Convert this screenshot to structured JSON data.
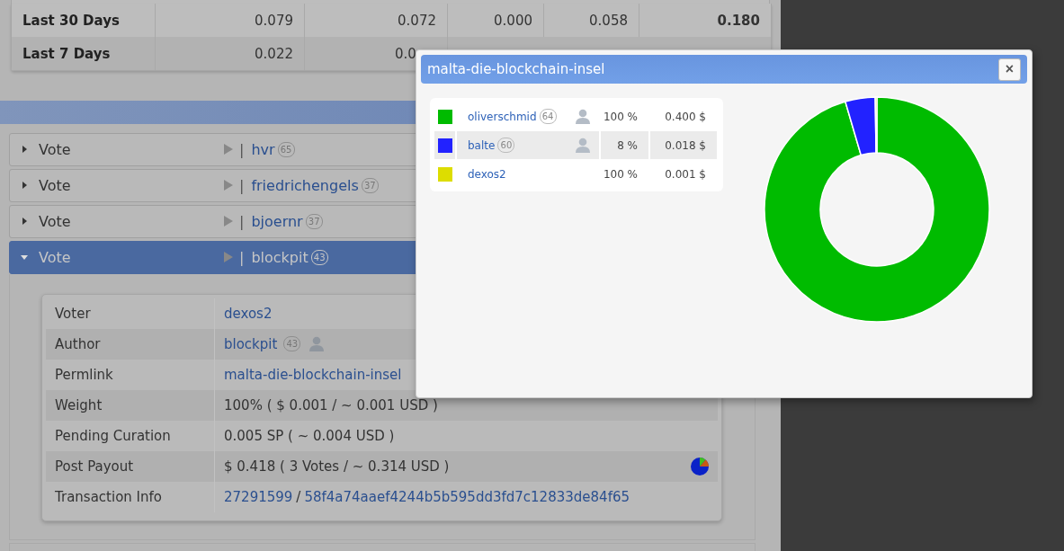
{
  "stats": {
    "rows": [
      {
        "label": "Last 30 Days",
        "cells": [
          "0.079",
          "0.072",
          "0.000",
          "0.058",
          "0.180"
        ]
      },
      {
        "label": "Last 7 Days",
        "cells": [
          "0.022",
          "0.0"
        ]
      }
    ]
  },
  "votes": [
    {
      "label": "Vote",
      "separator": "|",
      "voter": "hvr",
      "reputation": "65",
      "expanded": false
    },
    {
      "label": "Vote",
      "separator": "|",
      "voter": "friedrichengels",
      "reputation": "37",
      "expanded": false
    },
    {
      "label": "Vote",
      "separator": "|",
      "voter": "bjoernr",
      "reputation": "37",
      "expanded": false
    },
    {
      "label": "Vote",
      "separator": "|",
      "voter": "blockpit",
      "reputation": "43",
      "expanded": true
    }
  ],
  "details": [
    {
      "label": "Voter",
      "kind": "link",
      "value": "dexos2"
    },
    {
      "label": "Author",
      "kind": "author",
      "value": "blockpit",
      "reputation": "43"
    },
    {
      "label": "Permlink",
      "kind": "link",
      "value": "malta-die-blockchain-insel"
    },
    {
      "label": "Weight",
      "kind": "text",
      "value": "100% ( $ 0.001 / ~ 0.001 USD )"
    },
    {
      "label": "Pending Curation",
      "kind": "text",
      "value": "0.005 SP ( ~ 0.004 USD )"
    },
    {
      "label": "Post Payout",
      "kind": "payout",
      "value": "$ 0.418 ( 3 Votes / ~ 0.314 USD )"
    },
    {
      "label": "Transaction Info",
      "kind": "tx",
      "block": "27291599",
      "separator": "/",
      "hash": "58f4a74aaef4244b5b595dd3fd7c12833de84f65"
    }
  ],
  "modal": {
    "title": "malta-die-blockchain-insel",
    "close": "×",
    "voters": [
      {
        "name": "oliverschmid",
        "reputation": "64",
        "color": "#00bb00",
        "profile": true,
        "percent": "100 %",
        "amount": "0.400 $",
        "highlighted": false
      },
      {
        "name": "balte",
        "reputation": "60",
        "color": "#2222ff",
        "profile": true,
        "percent": "8 %",
        "amount": "0.018 $",
        "highlighted": true
      },
      {
        "name": "dexos2",
        "color": "#dddd00",
        "profile": false,
        "percent": "100 %",
        "amount": "0.001 $",
        "highlighted": false
      }
    ],
    "chart_data": {
      "type": "donut",
      "values": [
        95.46,
        4.3,
        0.24
      ]
    }
  }
}
